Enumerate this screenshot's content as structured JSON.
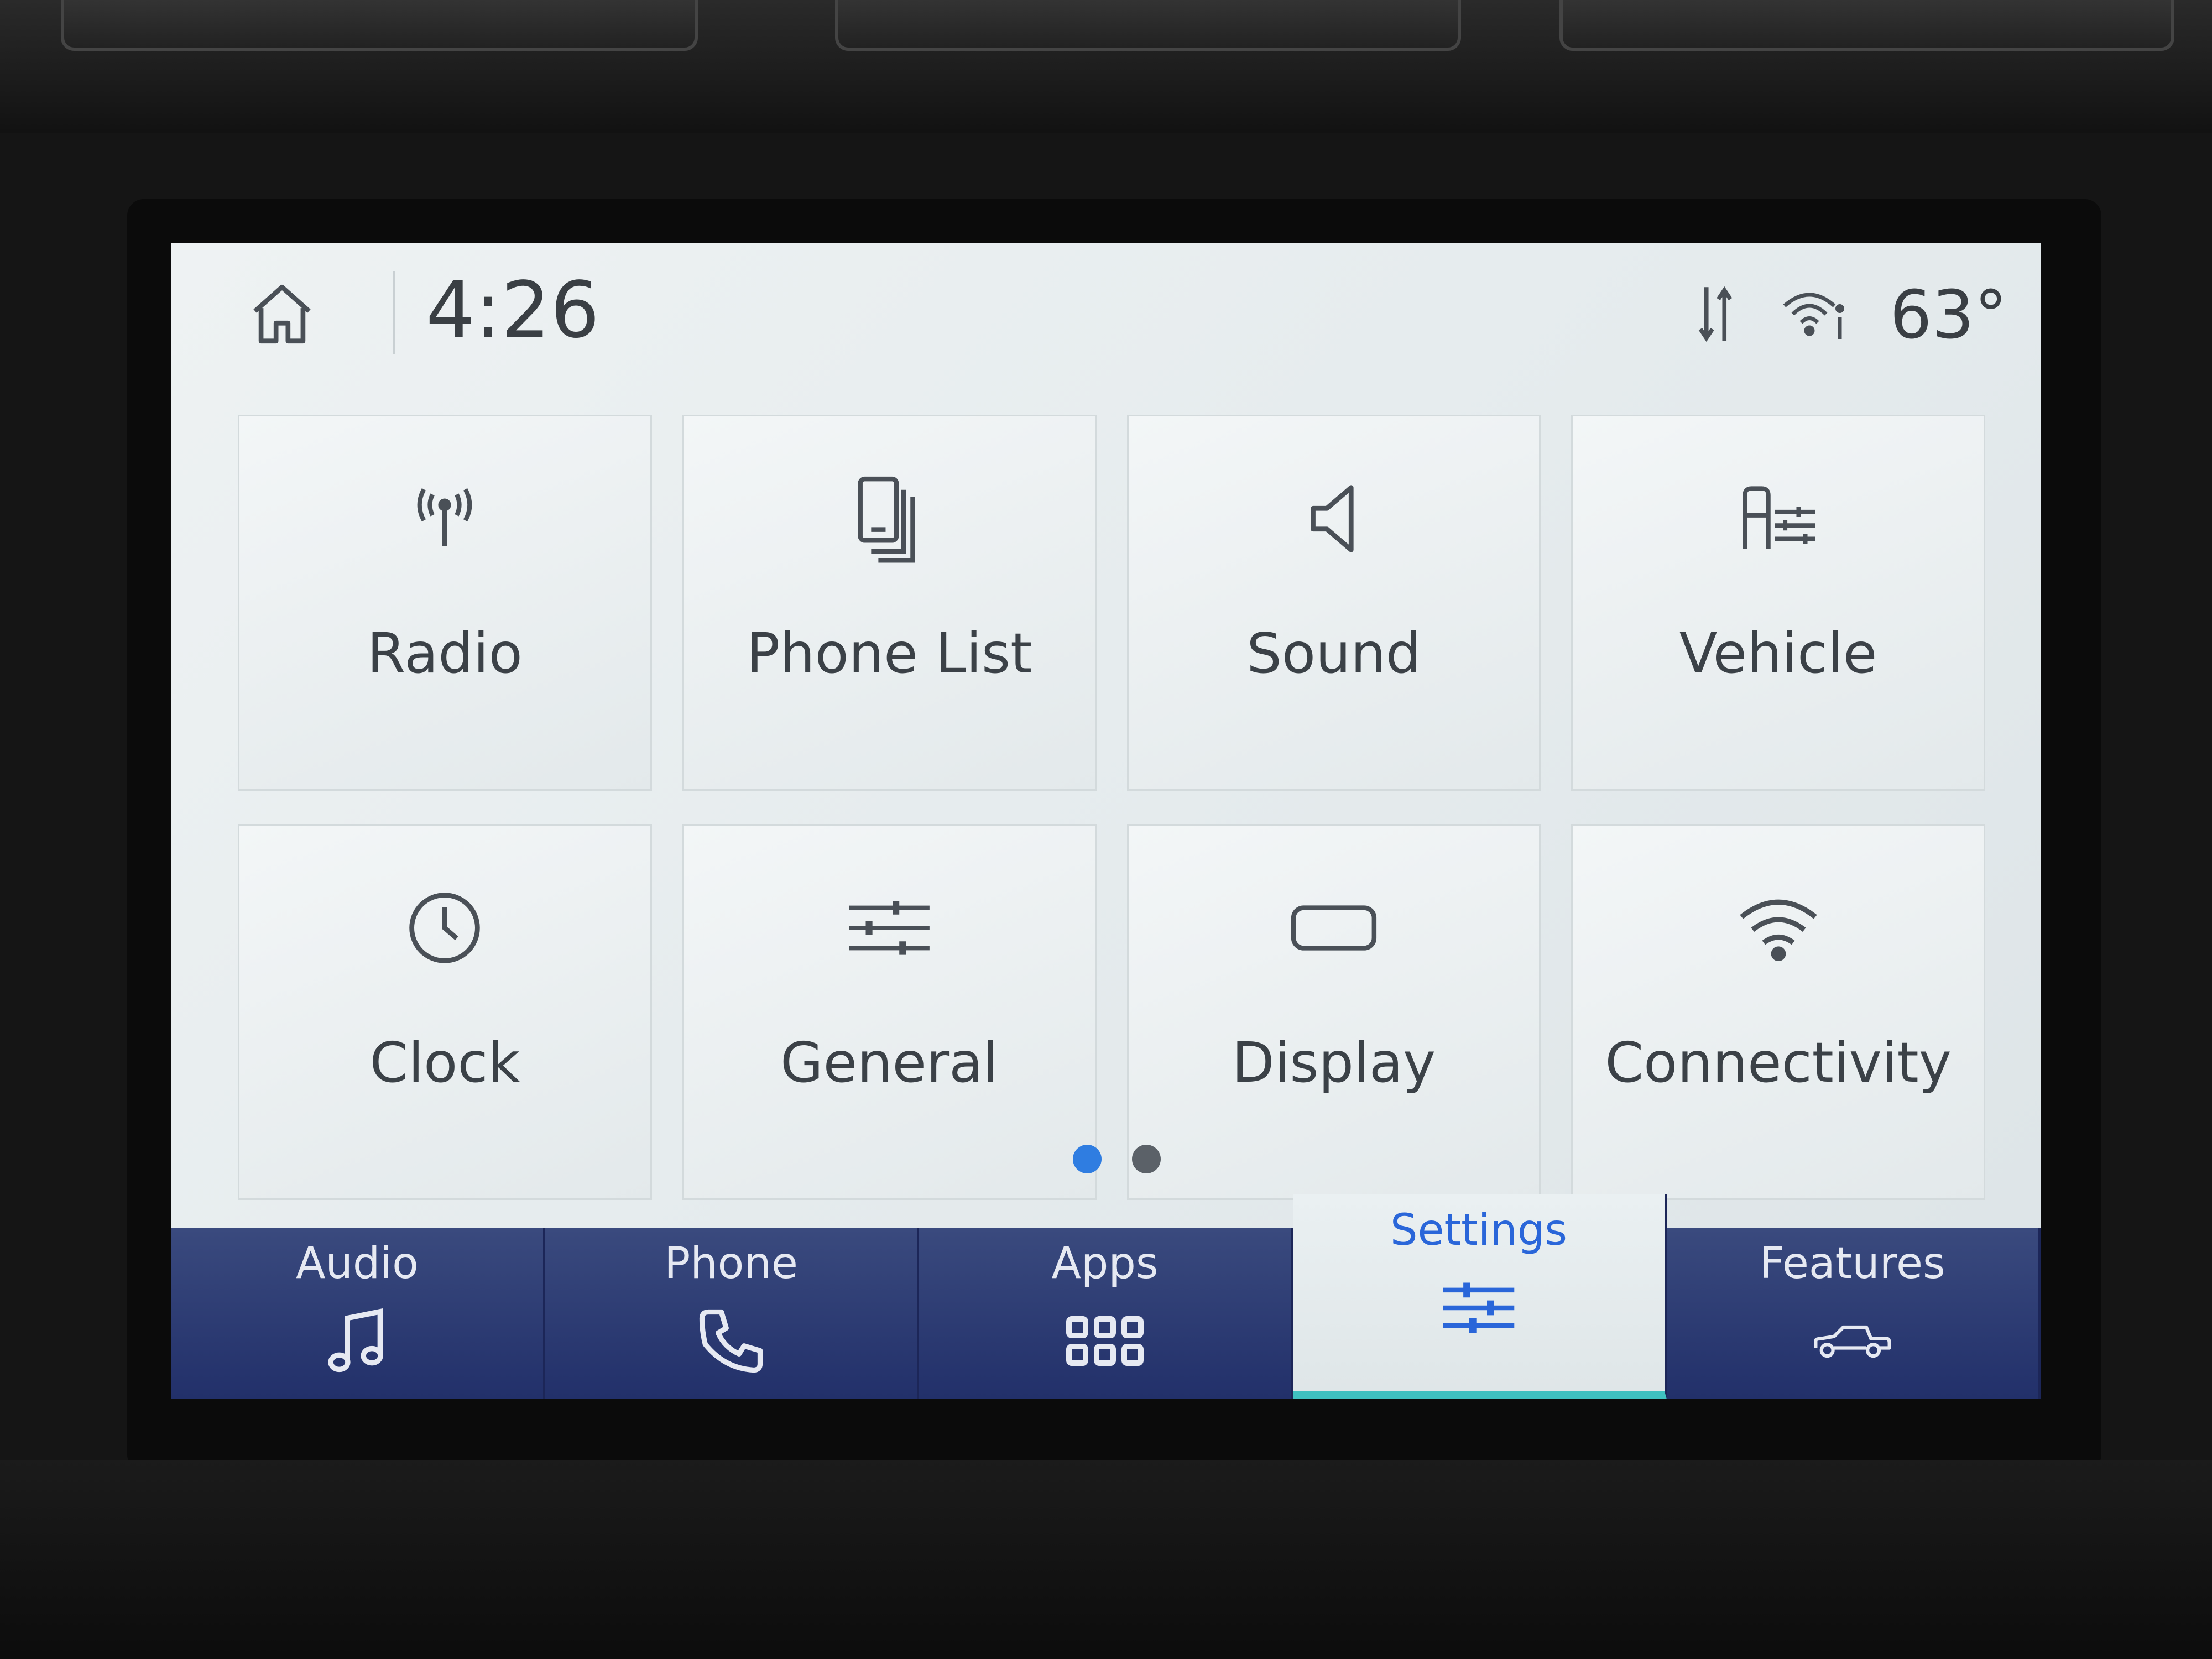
{
  "status_bar": {
    "time": "4:26",
    "temperature": "63°"
  },
  "settings_grid": [
    {
      "label": "Radio",
      "icon": "radio-antenna-icon"
    },
    {
      "label": "Phone List",
      "icon": "phone-list-icon"
    },
    {
      "label": "Sound",
      "icon": "speaker-icon"
    },
    {
      "label": "Vehicle",
      "icon": "vehicle-settings-icon"
    },
    {
      "label": "Clock",
      "icon": "clock-icon"
    },
    {
      "label": "General",
      "icon": "sliders-icon"
    },
    {
      "label": "Display",
      "icon": "display-icon"
    },
    {
      "label": "Connectivity",
      "icon": "wifi-icon"
    }
  ],
  "pagination": {
    "current": 1,
    "total": 2
  },
  "bottom_nav": {
    "tabs": [
      {
        "label": "Audio",
        "icon": "music-note-icon"
      },
      {
        "label": "Phone",
        "icon": "phone-handset-icon"
      },
      {
        "label": "Apps",
        "icon": "apps-grid-icon"
      },
      {
        "label": "Settings",
        "icon": "settings-sliders-icon",
        "active": true
      },
      {
        "label": "Features",
        "icon": "truck-icon"
      }
    ]
  },
  "colors": {
    "active_tab_text": "#2a66d9",
    "nav_background": "#2a3872",
    "active_dot": "#2f7de1",
    "inactive_dot": "#5b6168",
    "active_underline": "#3fc0c0"
  }
}
